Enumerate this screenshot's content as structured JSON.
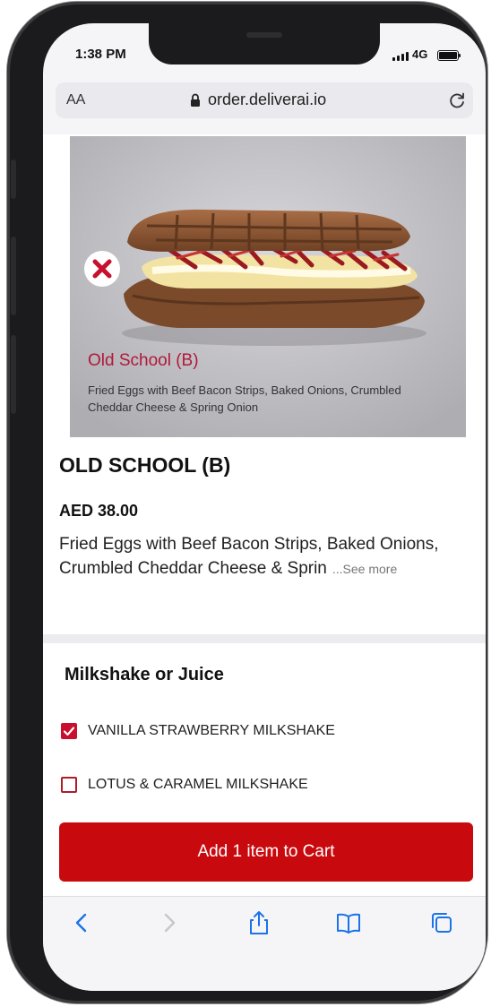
{
  "status_bar": {
    "time": "1:38 PM",
    "network": "4G"
  },
  "browser": {
    "text_size_label": "AA",
    "url": "order.deliverai.io"
  },
  "hero": {
    "title": "Old School (B)",
    "description": "Fried Eggs with Beef Bacon Strips, Baked Onions, Crumbled Cheddar Cheese & Spring Onion"
  },
  "product": {
    "name": "OLD SCHOOL (B)",
    "price": "AED 38.00",
    "description": "Fried Eggs with Beef Bacon Strips, Baked Onions, Crumbled Cheddar Cheese & Sprin",
    "see_more": "...See more"
  },
  "options_section": {
    "title": "Milkshake or Juice",
    "options": [
      {
        "label": "VANILLA STRAWBERRY MILKSHAKE",
        "checked": true
      },
      {
        "label": "LOTUS & CARAMEL MILKSHAKE",
        "checked": false
      }
    ]
  },
  "cart_button": {
    "label": "Add 1 item to Cart"
  },
  "colors": {
    "accent": "#c8090e",
    "hero_title": "#b2183a"
  },
  "toolbar_icons": [
    "back-icon",
    "forward-icon",
    "share-icon",
    "bookmarks-icon",
    "tabs-icon"
  ]
}
